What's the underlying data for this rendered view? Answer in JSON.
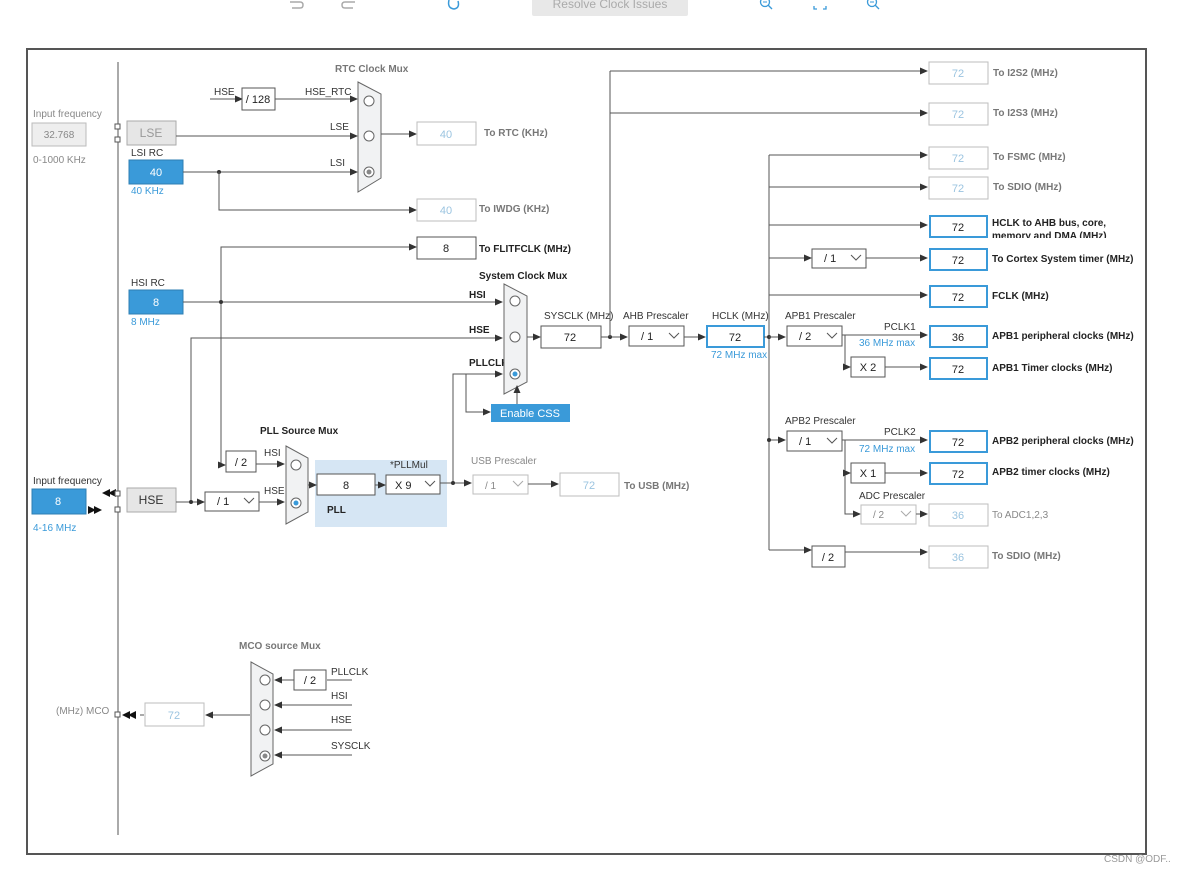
{
  "toolbar": {
    "resolve_label": "Resolve Clock Issues"
  },
  "left": {
    "lse_input_freq_label": "Input frequency",
    "lse_input_value": "32.768",
    "lse_range": "0-1000 KHz",
    "lse_label": "LSE",
    "lsi_rc_label": "LSI RC",
    "lsi_value": "40",
    "lsi_freq": "40 KHz",
    "hsi_rc_label": "HSI RC",
    "hsi_value": "8",
    "hsi_freq": "8 MHz",
    "hse_input_freq_label": "Input frequency",
    "hse_input_value": "8",
    "hse_range": "4-16 MHz",
    "hse_label": "HSE",
    "mco_label": "(MHz) MCO",
    "mco_value": "72"
  },
  "rtc": {
    "title": "RTC Clock Mux",
    "hse_label": "HSE",
    "div128": "/ 128",
    "hse_rtc": "HSE_RTC",
    "lse": "LSE",
    "lsi": "LSI",
    "to_rtc_value": "40",
    "to_rtc_label": "To RTC (KHz)",
    "iwdg_value": "40",
    "iwdg_label": "To IWDG (KHz)",
    "flit_value": "8",
    "flit_label": "To FLITFCLK (MHz)"
  },
  "sysmux": {
    "title": "System Clock Mux",
    "hsi": "HSI",
    "hse": "HSE",
    "pllclk": "PLLCLK",
    "enable_css": "Enable CSS",
    "sysclk_label": "SYSCLK (MHz)",
    "sysclk_value": "72",
    "ahb_label": "AHB Prescaler",
    "ahb_value": "/ 1",
    "hclk_label": "HCLK (MHz)",
    "hclk_value": "72",
    "hclk_max": "72 MHz max"
  },
  "pll": {
    "title": "PLL Source Mux",
    "div2": "/ 2",
    "hsi": "HSI",
    "hse": "HSE",
    "hse_div": "/ 1",
    "pll_value": "8",
    "pllmul_label": "*PLLMul",
    "pllmul_value": "X 9",
    "pll_label": "PLL",
    "usb_label": "USB Prescaler",
    "usb_div": "/ 1",
    "usb_value": "72",
    "usb_out": "To USB (MHz)"
  },
  "outputs": {
    "i2s2_value": "72",
    "i2s2_label": "To I2S2 (MHz)",
    "i2s3_value": "72",
    "i2s3_label": "To I2S3 (MHz)",
    "fsmc_value": "72",
    "fsmc_label": "To FSMC (MHz)",
    "sdio1_value": "72",
    "sdio1_label": "To SDIO (MHz)",
    "hclk_ahb_value": "72",
    "hclk_ahb_label1": "HCLK to AHB bus, core,",
    "hclk_ahb_label2": "memory and DMA (MHz)",
    "cortex_div": "/ 1",
    "cortex_value": "72",
    "cortex_label": "To Cortex System timer (MHz)",
    "fclk_value": "72",
    "fclk_label": "FCLK (MHz)",
    "apb1_label": "APB1 Prescaler",
    "apb1_div": "/ 2",
    "pclk1": "PCLK1",
    "pclk1_max": "36 MHz max",
    "apb1_periph_value": "36",
    "apb1_periph_label": "APB1 peripheral clocks (MHz)",
    "apb1_timer_mul": "X 2",
    "apb1_timer_value": "72",
    "apb1_timer_label": "APB1 Timer clocks (MHz)",
    "apb2_label": "APB2 Prescaler",
    "apb2_div": "/ 1",
    "pclk2": "PCLK2",
    "pclk2_max": "72 MHz max",
    "apb2_periph_value": "72",
    "apb2_periph_label": "APB2 peripheral clocks (MHz)",
    "apb2_timer_mul": "X 1",
    "apb2_timer_value": "72",
    "apb2_timer_label": "APB2 timer clocks (MHz)",
    "adc_label": "ADC Prescaler",
    "adc_div": "/ 2",
    "adc_value": "36",
    "adc_out": "To ADC1,2,3",
    "sdio2_div": "/ 2",
    "sdio2_value": "36",
    "sdio2_label": "To SDIO (MHz)"
  },
  "mco": {
    "title": "MCO source Mux",
    "div2": "/ 2",
    "pllclk": "PLLCLK",
    "hsi": "HSI",
    "hse": "HSE",
    "sysclk": "SYSCLK"
  },
  "watermark": "CSDN @ODF.."
}
